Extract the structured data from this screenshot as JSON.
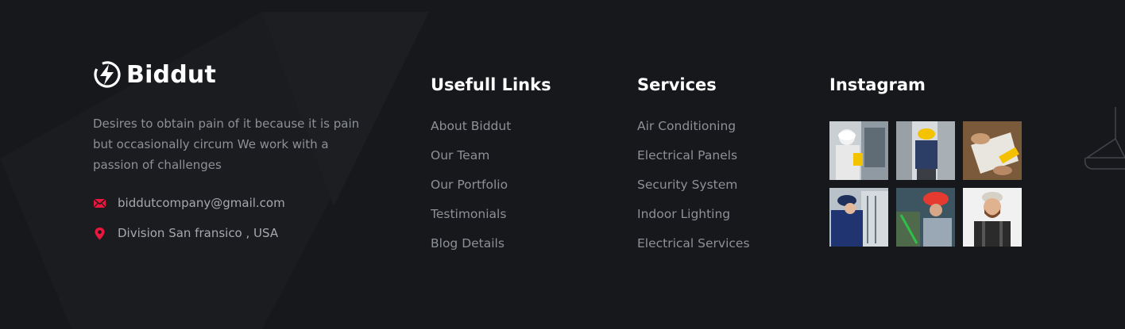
{
  "brand": {
    "name": "Biddut",
    "logo_icon": "lightning-bolt-icon"
  },
  "about": {
    "text": "Desires to obtain pain of it because it is pain but occasionally circum We work with a passion of challenges"
  },
  "contacts": [
    {
      "icon": "envelope-icon",
      "text": "biddutcompany@gmail.com"
    },
    {
      "icon": "location-pin-icon",
      "text": "Division San fransico , USA"
    }
  ],
  "useful_links": {
    "title": "Usefull Links",
    "items": [
      "About Biddut",
      "Our Team",
      "Our Portfolio",
      "Testimonials",
      "Blog Details"
    ]
  },
  "services": {
    "title": "Services",
    "items": [
      "Air Conditioning",
      "Electrical Panels",
      "Security System",
      "Indoor Lighting",
      "Electrical Services"
    ]
  },
  "instagram": {
    "title": "Instagram",
    "photos": [
      "electrician-panel-photo",
      "worker-back-photo",
      "blueprint-tools-photo",
      "technician-wiring-photo",
      "hardhat-worker-photo",
      "bearded-man-photo"
    ]
  },
  "colors": {
    "background": "#17181c",
    "accent": "#e8173d",
    "muted_text": "#8e9097"
  }
}
